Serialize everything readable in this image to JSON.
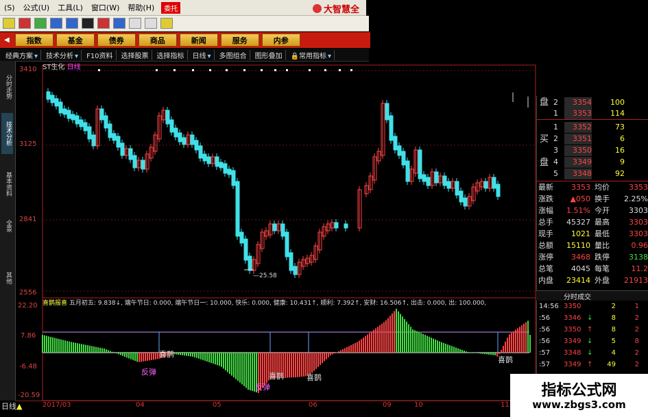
{
  "menu": {
    "items": [
      "(S)",
      "公式(U)",
      "工具(L)",
      "窗口(W)",
      "帮助(H)"
    ],
    "tag": "委托",
    "brand": "大智慧全"
  },
  "categories": [
    "指数",
    "基金",
    "债券",
    "商品",
    "新闻",
    "服务",
    "内参"
  ],
  "toolbar": [
    "经典方案",
    "技术分析",
    "F10资料",
    "选择股票",
    "选择指标",
    "日线",
    "多图组合",
    "图形叠加",
    "常用指标"
  ],
  "left_tabs": [
    "分时走势",
    "技术分析",
    "基本资料",
    "全景",
    "其他"
  ],
  "main": {
    "stock_title": "ST生化",
    "period": "日线",
    "y_ticks": [
      "3410",
      "3125",
      "2841",
      "2556"
    ],
    "low_label": "25.58",
    "bottom_label": "日线"
  },
  "indicator": {
    "name": "喜鹊报喜",
    "line": "五月初五: 9.838↓, 端午节日: 0.000, 端午节日一: 10.000, 快乐: 0.000, 健康: 10.431↑, 顺利: 7.392↑, 安财: 16.506↑, 出击: 0.000, 出: 100.000,",
    "y_ticks": [
      "22.20",
      "7.86",
      "-6.48",
      "-20.59"
    ],
    "signals": [
      "喜鹊",
      "反弹",
      "喜鹊",
      "反弹",
      "喜鹊",
      "喜鹊"
    ]
  },
  "x_dates": [
    "2017/03",
    "04",
    "05",
    "06",
    "09",
    "10",
    "11"
  ],
  "order_book": {
    "sell_label": "盘",
    "buy_label1": "买",
    "buy_label2": "盘",
    "asks": [
      {
        "level": "2",
        "price": "3354",
        "vol": "100"
      },
      {
        "level": "1",
        "price": "3353",
        "vol": "114"
      }
    ],
    "bids": [
      {
        "level": "1",
        "price": "3352",
        "vol": "73"
      },
      {
        "level": "2",
        "price": "3351",
        "vol": "6"
      },
      {
        "level": "3",
        "price": "3350",
        "vol": "16"
      },
      {
        "level": "4",
        "price": "3349",
        "vol": "9"
      },
      {
        "level": "5",
        "price": "3348",
        "vol": "92"
      }
    ]
  },
  "quote": [
    {
      "l1": "最新",
      "v1": "3353",
      "l2": "均价",
      "v2": "3353"
    },
    {
      "l1": "涨跌",
      "v1": "▲050",
      "l2": "换手",
      "v2": "2.25%"
    },
    {
      "l1": "涨幅",
      "v1": "1.51%",
      "l2": "今开",
      "v2": "3303"
    },
    {
      "l1": "总手",
      "v1": "45327",
      "l2": "最高",
      "v2": "3303"
    },
    {
      "l1": "现手",
      "v1": "1021",
      "l2": "最低",
      "v2": "3303"
    },
    {
      "l1": "总额",
      "v1": "15110",
      "l2": "量比",
      "v2": "0.96"
    },
    {
      "l1": "涨停",
      "v1": "3468",
      "l2": "跌停",
      "v2": "3138"
    },
    {
      "l1": "总笔",
      "v1": "4045",
      "l2": "每笔",
      "v2": "11.2"
    },
    {
      "l1": "内盘",
      "v1": "23414",
      "l2": "外盘",
      "v2": "21913"
    }
  ],
  "ticks_header": "分时成交",
  "ticks": [
    {
      "t": "14:56",
      "p": "3350",
      "a": "",
      "v": "2",
      "s": "1"
    },
    {
      "t": ":56",
      "p": "3346",
      "a": "↓",
      "v": "8",
      "s": "2"
    },
    {
      "t": ":56",
      "p": "3350",
      "a": "↑",
      "v": "8",
      "s": "2"
    },
    {
      "t": ":56",
      "p": "3349",
      "a": "↓",
      "v": "5",
      "s": "8"
    },
    {
      "t": ":57",
      "p": "3348",
      "a": "↓",
      "v": "4",
      "s": "2"
    },
    {
      "t": ":57",
      "p": "3349",
      "a": "↑",
      "v": "49",
      "s": "2"
    }
  ],
  "watermark": {
    "line1": "指标公式网",
    "line2": "www.zbgs3.com"
  },
  "colors": {
    "up": "#ff4444",
    "down": "#40e0e8",
    "menu_red": "#c71b0f"
  }
}
